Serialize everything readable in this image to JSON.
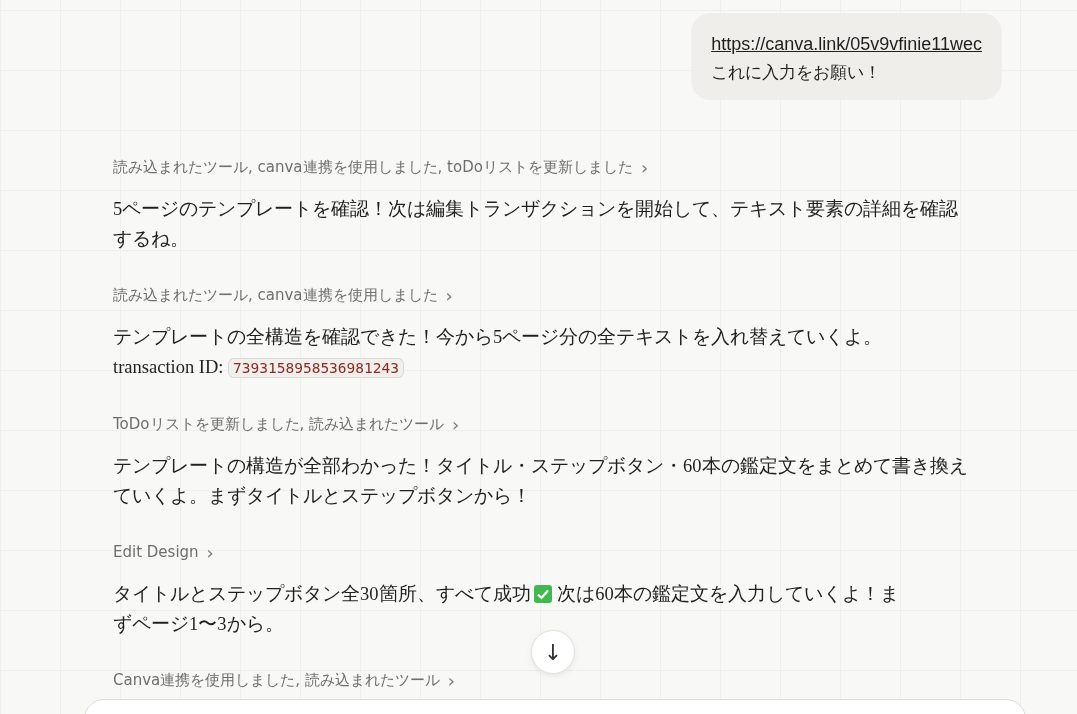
{
  "user_message": {
    "link": "https://canva.link/05v9vfinie11wec",
    "text": "これに入力をお願い！"
  },
  "steps": [
    {
      "tool_header": "読み込まれたツール, canva連携を使用しました, toDoリストを更新しました",
      "chevron": "›",
      "paragraph": [
        {
          "kind": "text",
          "text": "5ページのテンプレートを確認！次は編集トランザクションを開始して、テキスト要素の詳細を確認するね。"
        }
      ]
    },
    {
      "tool_header": "読み込まれたツール, canva連携を使用しました",
      "chevron": "›",
      "paragraph": [
        {
          "kind": "text",
          "text": "テンプレートの全構造を確認できた！今から5ページ分の全テキストを入れ替えていくよ。"
        },
        {
          "kind": "break"
        },
        {
          "kind": "text",
          "text": "transaction ID: "
        },
        {
          "kind": "code",
          "text": "7393158958536981243"
        }
      ]
    },
    {
      "tool_header": "ToDoリストを更新しました, 読み込まれたツール",
      "chevron": "›",
      "paragraph": [
        {
          "kind": "text",
          "text": "テンプレートの構造が全部わかった！タイトル・ステップボタン・60本の鑑定文をまとめて書き換えていくよ。まずタイトルとステップボタンから！"
        }
      ]
    },
    {
      "tool_header": "Edit Design",
      "chevron": "›",
      "paragraph": [
        {
          "kind": "text",
          "text": "タイトルとステップボタン全30箇所、すべて成功"
        },
        {
          "kind": "check"
        },
        {
          "kind": "line",
          "text": " 次は60本の鑑定文を入力していくよ！ま"
        },
        {
          "kind": "break"
        },
        {
          "kind": "text",
          "text": "ずページ1〜3から。"
        }
      ]
    },
    {
      "tool_header": "Canva連携を使用しました, 読み込まれたツール",
      "chevron": "›"
    }
  ],
  "scroll_button": "↓"
}
